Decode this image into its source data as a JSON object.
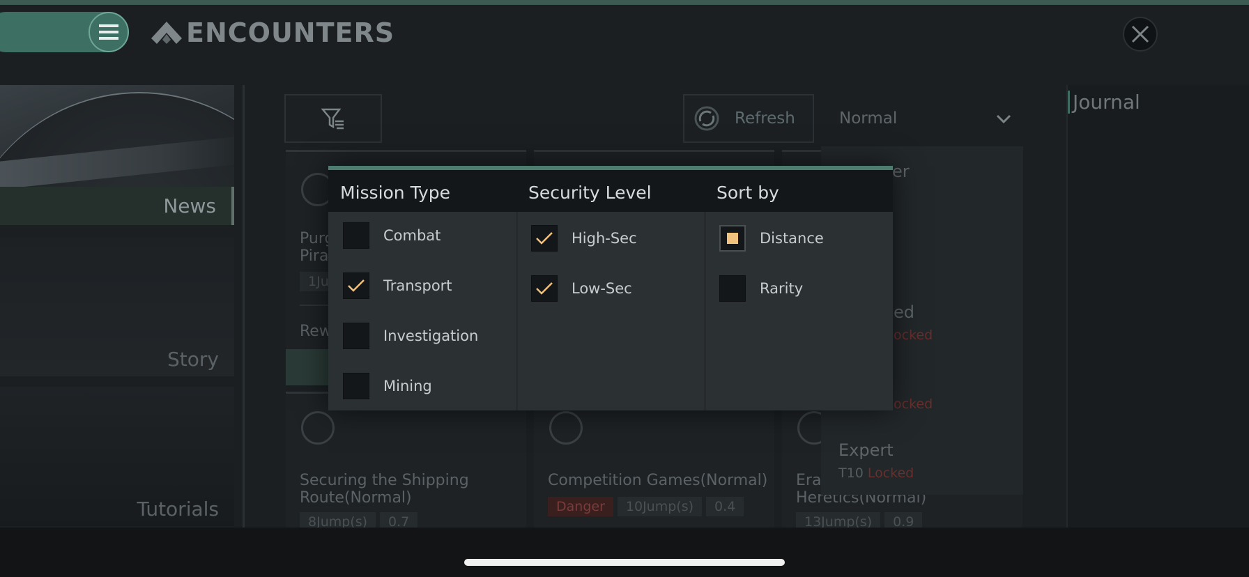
{
  "header": {
    "title": "ENCOUNTERS"
  },
  "sidebar": {
    "items": [
      {
        "label": "News",
        "selected": true
      },
      {
        "label": "Story",
        "selected": false
      },
      {
        "label": "Tutorials",
        "selected": false
      }
    ]
  },
  "toolbar": {
    "refresh_label": "Refresh",
    "difficulty_value": "Normal"
  },
  "missions": [
    {
      "title": "Purg\nPira",
      "tags": [
        "1Ju"
      ],
      "extra": "Rew"
    },
    {
      "title": "Securing the Shipping\nRoute(Normal)",
      "tags": [
        "8Jump(s)",
        "0.7"
      ]
    },
    {
      "title": "Competition Games(Normal)",
      "tags": [
        "Danger",
        "10Jump(s)",
        "0.4"
      ]
    },
    {
      "title": "Era\nHeretics(Normal)",
      "tags": [
        "13Jump(s)",
        "0.9"
      ]
    }
  ],
  "difficulty_list": [
    {
      "label": "er",
      "sub": ""
    },
    {
      "label": "ed",
      "sub": "ocked"
    },
    {
      "label": "",
      "sub": "ocked"
    },
    {
      "label": "Expert",
      "sub_prefix": "T10",
      "sub": "Locked"
    }
  ],
  "journal": {
    "title": "Journal"
  },
  "filter_popup": {
    "columns": [
      {
        "title": "Mission Type",
        "options": [
          {
            "label": "Combat",
            "checked": false
          },
          {
            "label": "Transport",
            "checked": true
          },
          {
            "label": "Investigation",
            "checked": false
          },
          {
            "label": "Mining",
            "checked": false
          }
        ]
      },
      {
        "title": "Security Level",
        "options": [
          {
            "label": "High-Sec",
            "checked": true
          },
          {
            "label": "Low-Sec",
            "checked": true
          }
        ]
      },
      {
        "title": "Sort by",
        "options": [
          {
            "label": "Distance",
            "selected": true
          },
          {
            "label": "Rarity",
            "selected": false
          }
        ]
      }
    ]
  },
  "colors": {
    "accent": "#4d7d6f",
    "check": "#f2c27f",
    "danger": "#7a3c3a"
  }
}
